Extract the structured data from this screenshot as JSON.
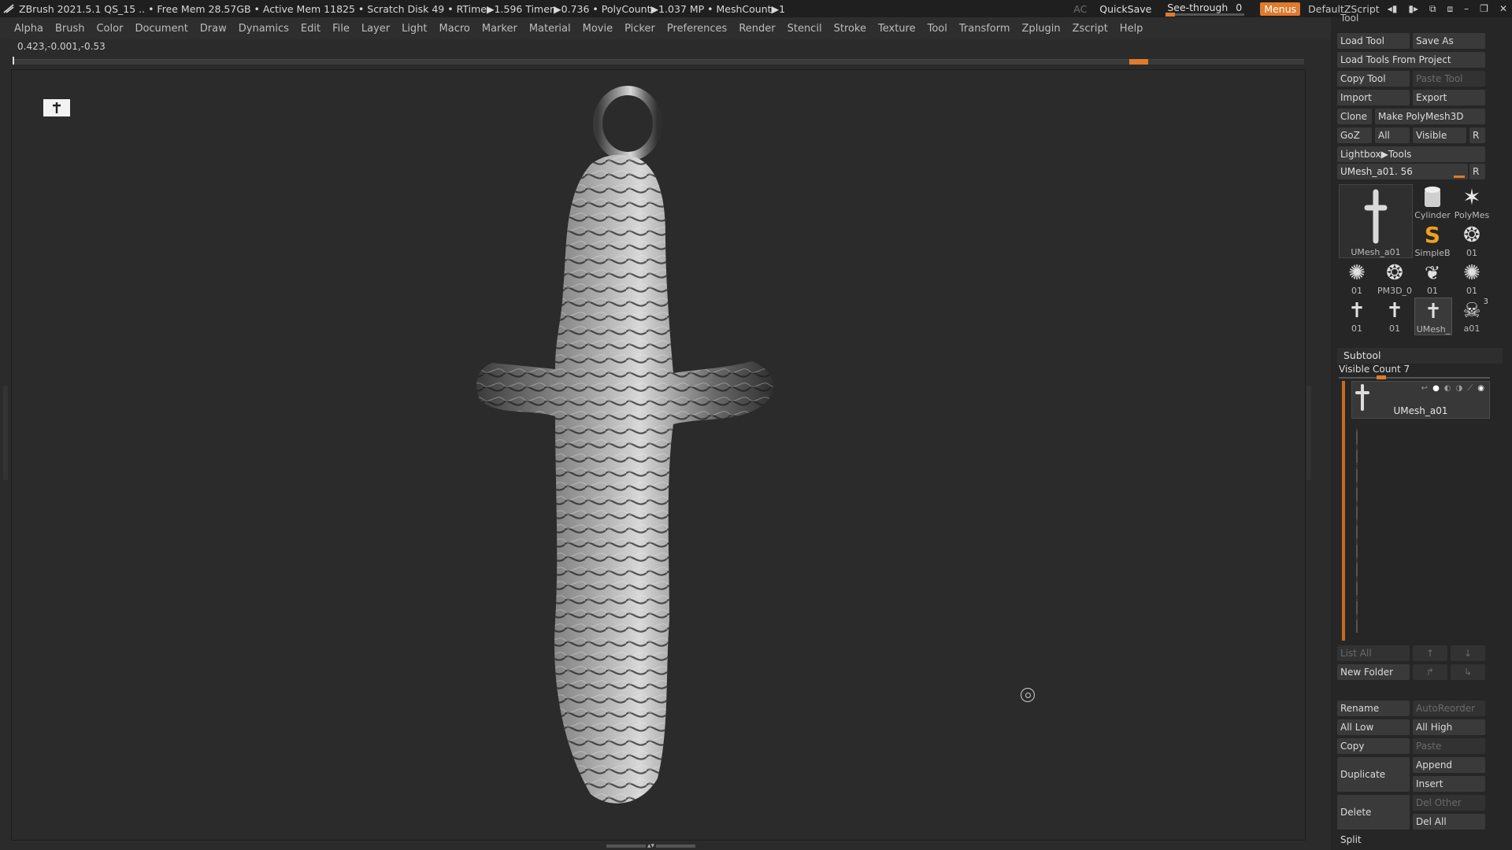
{
  "title_bar": {
    "title": "ZBrush 2021.5.1   QS_15   .. • Free Mem 28.57GB • Active Mem 11825 • Scratch Disk 49 • RTime▶1.596 Timer▶0.736 • PolyCount▶1.037 MP  • MeshCount▶1",
    "ac_label": "AC",
    "quicksave_label": "QuickSave",
    "see_through_label": "See-through",
    "see_through_value": "0",
    "menus_label": "Menus",
    "script_label": "DefaultZScript"
  },
  "menu_bar": {
    "items": [
      "Alpha",
      "Brush",
      "Color",
      "Document",
      "Draw",
      "Dynamics",
      "Edit",
      "File",
      "Layer",
      "Light",
      "Macro",
      "Marker",
      "Material",
      "Movie",
      "Picker",
      "Preferences",
      "Render",
      "Stencil",
      "Stroke",
      "Texture",
      "Tool",
      "Transform",
      "Zplugin",
      "Zscript",
      "Help"
    ]
  },
  "coords": "0.423,-0.001,-0.53",
  "tool_panel": {
    "title": "Tool",
    "load_tool": "Load Tool",
    "save_as": "Save As",
    "load_tools_from_project": "Load Tools From Project",
    "copy_tool": "Copy Tool",
    "paste_tool": "Paste Tool",
    "import": "Import",
    "export": "Export",
    "clone": "Clone",
    "make_polymesh3d": "Make PolyMesh3D",
    "goz": "GoZ",
    "all": "All",
    "visible": "Visible",
    "r": "R",
    "lightbox_tools": "Lightbox▶Tools",
    "current_tool_slider": "UMesh_a01. 56",
    "tools": [
      {
        "label": "UMesh_a01",
        "icon": "cross-icon"
      },
      {
        "label": "Cylinder",
        "icon": "cylinder-icon"
      },
      {
        "label": "PolyMes",
        "icon": "star-icon"
      },
      {
        "label": "SimpleB",
        "icon": "simplebrush-icon"
      },
      {
        "label": "01",
        "icon": "medallion-icon"
      },
      {
        "label": "01",
        "icon": "ornament-icon"
      },
      {
        "label": "PM3D_0",
        "icon": "medallion-icon"
      },
      {
        "label": "01",
        "icon": "leaf-icon"
      },
      {
        "label": "01",
        "icon": "ornament-icon"
      },
      {
        "label": "01",
        "icon": "cross-icon"
      },
      {
        "label": "01",
        "icon": "cross-icon"
      },
      {
        "label": "UMesh_",
        "icon": "cross-icon"
      },
      {
        "label": "a01",
        "icon": "skull-icon"
      }
    ],
    "badge_3": "3"
  },
  "subtool_panel": {
    "title": "Subtool",
    "visible_count": "Visible Count 7",
    "item_name": "UMesh_a01",
    "list_all": "List All",
    "new_folder": "New Folder",
    "rename": "Rename",
    "autoreorder": "AutoReorder",
    "all_low": "All Low",
    "all_high": "All High",
    "copy": "Copy",
    "paste": "Paste",
    "duplicate": "Duplicate",
    "append": "Append",
    "insert": "Insert",
    "del_other": "Del Other",
    "delete": "Delete",
    "del_all": "Del All",
    "split": "Split"
  },
  "colors": {
    "accent": "#e07a2c",
    "background": "#2b2b2b",
    "panel": "#262626"
  }
}
